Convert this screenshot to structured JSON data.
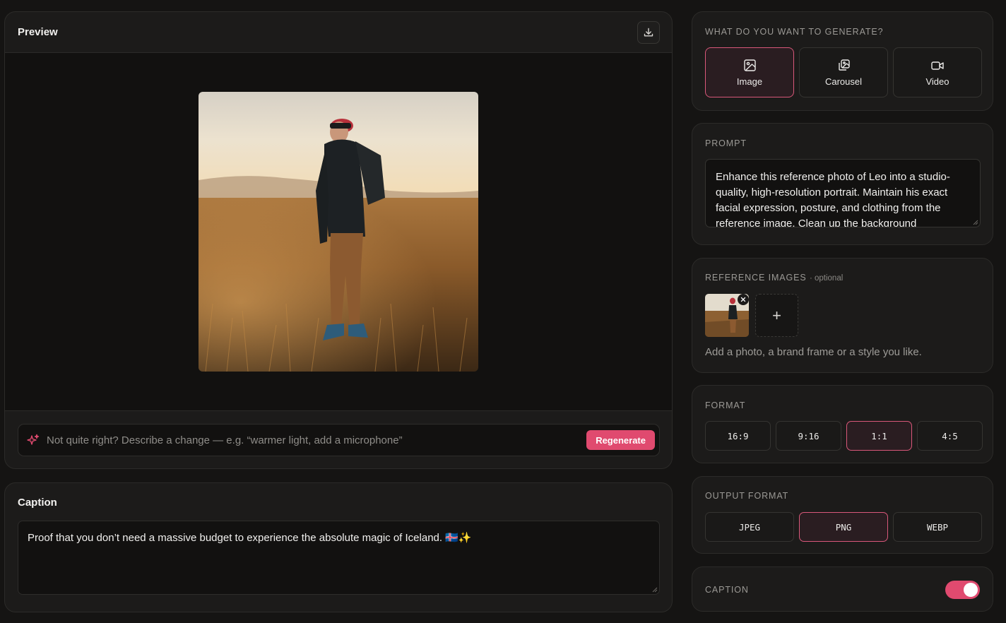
{
  "preview": {
    "title": "Preview",
    "download_icon": "download-icon",
    "regenerate_placeholder": "Not quite right? Describe a change — e.g. “warmer light, add a microphone”",
    "regenerate_icon": "sparkles-icon",
    "regenerate_label": "Regenerate"
  },
  "caption_editor": {
    "title": "Caption",
    "text": "Proof that you don’t need a massive budget to experience the absolute magic of Iceland. 🇮🇸✨"
  },
  "generate": {
    "label": "WHAT DO YOU WANT TO GENERATE?",
    "options": [
      {
        "label": "Image",
        "icon": "image-icon",
        "selected": true
      },
      {
        "label": "Carousel",
        "icon": "carousel-icon",
        "selected": false
      },
      {
        "label": "Video",
        "icon": "video-icon",
        "selected": false
      }
    ]
  },
  "prompt": {
    "label": "PROMPT",
    "text": "Enhance this reference photo of Leo into a studio-quality, high-resolution portrait. Maintain his exact facial expression, posture, and clothing from the reference image. Clean up the background"
  },
  "reference": {
    "label": "REFERENCE IMAGES",
    "optional": "· optional",
    "hint": "Add a photo, a brand frame or a style you like.",
    "add_symbol": "+"
  },
  "format": {
    "label": "FORMAT",
    "options": [
      {
        "label": "16:9",
        "selected": false
      },
      {
        "label": "9:16",
        "selected": false
      },
      {
        "label": "1:1",
        "selected": true
      },
      {
        "label": "4:5",
        "selected": false
      }
    ]
  },
  "output": {
    "label": "OUTPUT FORMAT",
    "options": [
      {
        "label": "JPEG",
        "selected": false
      },
      {
        "label": "PNG",
        "selected": true
      },
      {
        "label": "WEBP",
        "selected": false
      }
    ]
  },
  "caption_toggle": {
    "label": "CAPTION",
    "enabled": true
  },
  "colors": {
    "accent": "#e04a6f",
    "selected_border": "#d9587a",
    "background": "#151413",
    "panel": "#1c1b1a"
  }
}
